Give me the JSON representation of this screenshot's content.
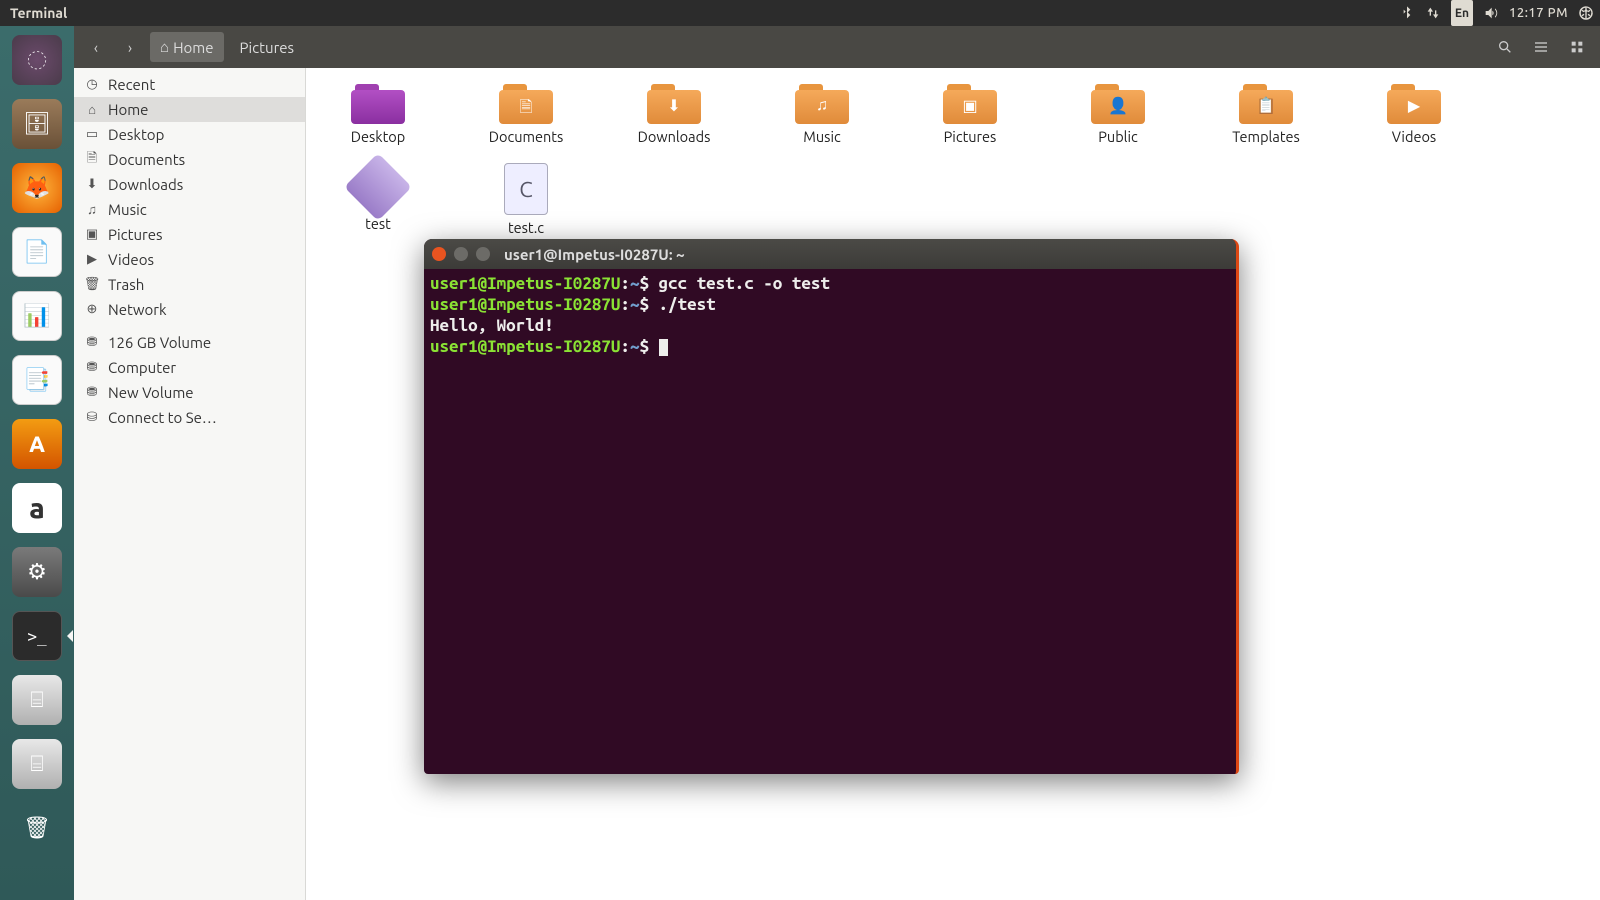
{
  "panel": {
    "app_label": "Terminal",
    "lang": "En",
    "clock": "12:17 PM"
  },
  "launcher": [
    {
      "id": "ubuntu",
      "glyph": "◌",
      "cls": "ubuntu"
    },
    {
      "id": "files",
      "glyph": "🗄",
      "cls": "files"
    },
    {
      "id": "firefox",
      "glyph": "🦊",
      "cls": "firefox"
    },
    {
      "id": "writer",
      "glyph": "📄",
      "cls": "writer"
    },
    {
      "id": "calc",
      "glyph": "📊",
      "cls": "calc"
    },
    {
      "id": "impress",
      "glyph": "📑",
      "cls": "impress"
    },
    {
      "id": "software",
      "glyph": "A",
      "cls": "software"
    },
    {
      "id": "amazon",
      "glyph": "a",
      "cls": "amazon"
    },
    {
      "id": "settings",
      "glyph": "⚙",
      "cls": "settings"
    },
    {
      "id": "terminal",
      "glyph": ">_",
      "cls": "terminal",
      "active": true
    },
    {
      "id": "drive1",
      "glyph": "⌸",
      "cls": "drive"
    },
    {
      "id": "drive2",
      "glyph": "⌸",
      "cls": "drive"
    },
    {
      "id": "trash",
      "glyph": "🗑",
      "cls": "trash"
    }
  ],
  "toolbar": {
    "path_home": "Home",
    "path_pictures": "Pictures"
  },
  "places": [
    {
      "icon": "◷",
      "label": "Recent"
    },
    {
      "icon": "⌂",
      "label": "Home",
      "selected": true
    },
    {
      "icon": "▭",
      "label": "Desktop"
    },
    {
      "icon": "🗎",
      "label": "Documents"
    },
    {
      "icon": "⬇",
      "label": "Downloads"
    },
    {
      "icon": "♫",
      "label": "Music"
    },
    {
      "icon": "▣",
      "label": "Pictures"
    },
    {
      "icon": "▶",
      "label": "Videos"
    },
    {
      "icon": "🗑",
      "label": "Trash"
    },
    {
      "icon": "⊕",
      "label": "Network"
    }
  ],
  "devices": [
    {
      "icon": "⛃",
      "label": "126 GB Volume"
    },
    {
      "icon": "⛃",
      "label": "Computer"
    },
    {
      "icon": "⛃",
      "label": "New Volume"
    },
    {
      "icon": "⛁",
      "label": "Connect to Se…"
    }
  ],
  "grid": [
    {
      "type": "folder",
      "variant": "desktop",
      "label": "Desktop",
      "badge": ""
    },
    {
      "type": "folder",
      "label": "Documents",
      "badge": "🗎"
    },
    {
      "type": "folder",
      "label": "Downloads",
      "badge": "⬇"
    },
    {
      "type": "folder",
      "label": "Music",
      "badge": "♫"
    },
    {
      "type": "folder",
      "label": "Pictures",
      "badge": "▣"
    },
    {
      "type": "folder",
      "label": "Public",
      "badge": "👤"
    },
    {
      "type": "folder",
      "label": "Templates",
      "badge": "📋"
    },
    {
      "type": "folder",
      "label": "Videos",
      "badge": "▶"
    },
    {
      "type": "diamond",
      "label": "test"
    },
    {
      "type": "file",
      "label": "test.c",
      "badge": "C"
    }
  ],
  "terminal": {
    "title": "user1@Impetus-I0287U: ~",
    "prompt_user": "user1@Impetus-I0287U",
    "prompt_path": "~",
    "lines": [
      {
        "cmd": "gcc test.c -o test"
      },
      {
        "cmd": "./test"
      },
      {
        "out": "Hello, World!"
      }
    ]
  }
}
